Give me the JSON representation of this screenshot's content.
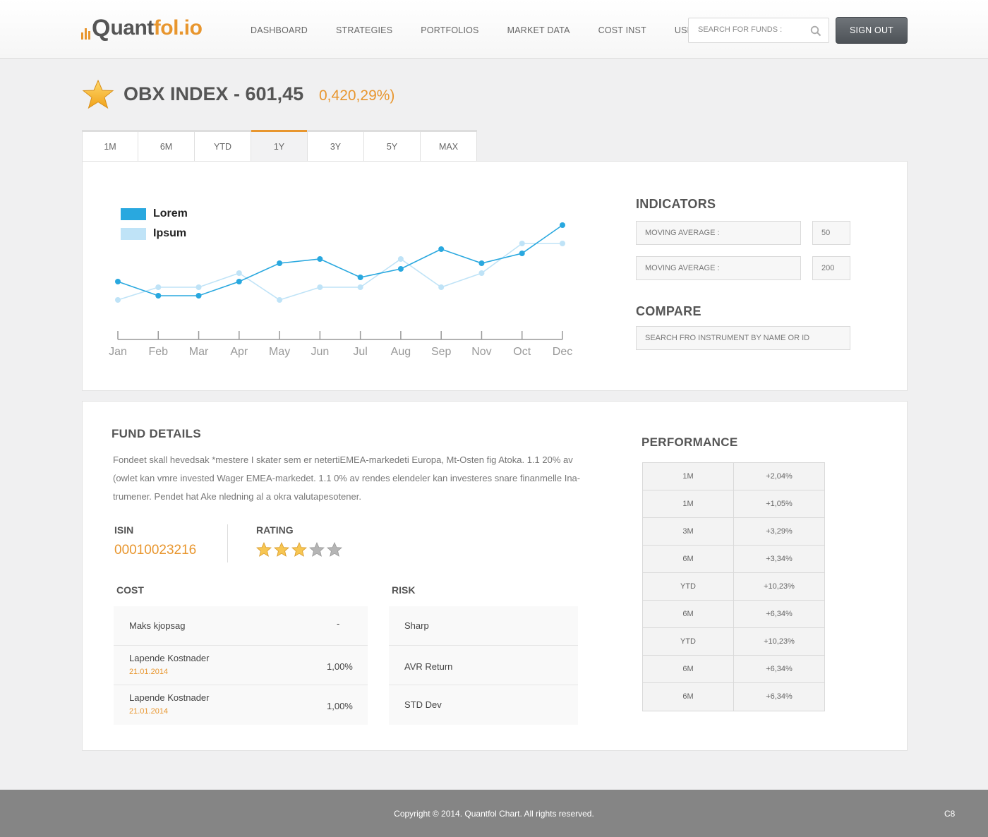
{
  "logo": {
    "q": "Q",
    "part1": "uant",
    "part2": "fol.io"
  },
  "nav": [
    "DASHBOARD",
    "STRATEGIES",
    "PORTFOLIOS",
    "MARKET DATA",
    "COST INST",
    "USERS"
  ],
  "search": {
    "placeholder": "SEARCH FOR FUNDS :"
  },
  "signout_label": "SIGN OUT",
  "title": {
    "name": "OBX INDEX - 601,45",
    "change": "0,420,29%)"
  },
  "tabs": [
    "1M",
    "6M",
    "YTD",
    "1Y",
    "3Y",
    "5Y",
    "MAX"
  ],
  "active_tab": "1Y",
  "chart_data": {
    "type": "line",
    "categories": [
      "Jan",
      "Feb",
      "Mar",
      "Apr",
      "May",
      "Jun",
      "Jul",
      "Aug",
      "Sep",
      "Nov",
      "Oct",
      "Dec"
    ],
    "series": [
      {
        "name": "Lorem",
        "color": "#29a8df",
        "values": [
          3.0,
          2.0,
          2.0,
          3.0,
          4.3,
          4.6,
          3.3,
          3.9,
          5.3,
          4.3,
          5.0,
          7.0
        ]
      },
      {
        "name": "Ipsum",
        "color": "#bfe3f7",
        "values": [
          1.7,
          2.6,
          2.6,
          3.6,
          1.7,
          2.6,
          2.6,
          4.6,
          2.6,
          3.6,
          5.7,
          5.7
        ]
      }
    ],
    "ylim": [
      0,
      8
    ],
    "grid": false,
    "legend": "top-left"
  },
  "indicators": {
    "heading": "INDICATORS",
    "fields": [
      {
        "label": "MOVING AVERAGE :",
        "value": "50"
      },
      {
        "label": "MOVING AVERAGE :",
        "value": "200"
      }
    ]
  },
  "compare": {
    "heading": "COMPARE",
    "placeholder": "SEARCH FRO INSTRUMENT BY NAME OR ID"
  },
  "fund": {
    "heading": "FUND DETAILS",
    "description": "Fondeet skall hevedsak *mestere I skater sem er netertiEMEA-markedeti Europa, Mt-Osten fig Atoka. 1.1 20% av (owlet kan vmre invested Wager EMEA-markedet. 1.1 0% av rendes elendeler kan investeres snare finanmelle Ina-trumener. Pendet hat Ake nledning al a okra valutapesotener.",
    "isin_label": "ISIN",
    "isin": "00010023216",
    "rating_label": "RATING",
    "rating": 3,
    "rating_max": 5
  },
  "cost": {
    "heading": "COST",
    "rows": [
      {
        "name": "Maks kjopsag",
        "date": "",
        "value": "-"
      },
      {
        "name": "Lapende Kostnader",
        "date": "21.01.2014",
        "value": "1,00%"
      },
      {
        "name": "Lapende Kostnader",
        "date": "21.01.2014",
        "value": "1,00%"
      }
    ]
  },
  "risk": {
    "heading": "RISK",
    "rows": [
      {
        "name": "Sharp"
      },
      {
        "name": "AVR Return"
      },
      {
        "name": "STD Dev"
      }
    ]
  },
  "performance": {
    "heading": "PERFORMANCE",
    "rows": [
      {
        "period": "1M",
        "value": "+2,04%"
      },
      {
        "period": "1M",
        "value": "+1,05%"
      },
      {
        "period": "3M",
        "value": "+3,29%"
      },
      {
        "period": "6M",
        "value": "+3,34%"
      },
      {
        "period": "YTD",
        "value": "+10,23%"
      },
      {
        "period": "6M",
        "value": "+6,34%"
      },
      {
        "period": "YTD",
        "value": "+10,23%"
      },
      {
        "period": "6M",
        "value": "+6,34%"
      },
      {
        "period": "6M",
        "value": "+6,34%"
      }
    ]
  },
  "footer": {
    "copyright": "Copyright © 2014. Quantfol Chart. All rights reserved.",
    "code": "C8"
  },
  "colors": {
    "accent": "#e8962e",
    "text": "#555555",
    "series1": "#29a8df",
    "series2": "#bfe3f7"
  }
}
